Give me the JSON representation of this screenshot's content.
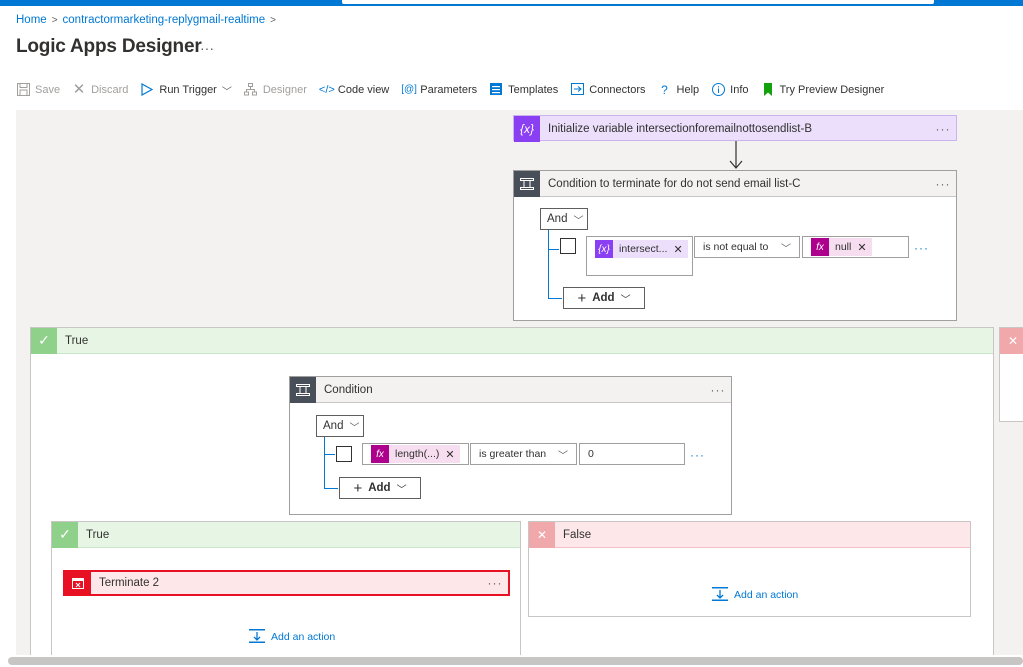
{
  "breadcrumb": {
    "home": "Home",
    "app": "contractormarketing-replygmail-realtime"
  },
  "page": {
    "title": "Logic Apps Designer",
    "more": "···"
  },
  "toolbar": {
    "save": "Save",
    "discard": "Discard",
    "run_trigger": "Run Trigger",
    "designer": "Designer",
    "code_view": "Code view",
    "parameters": "Parameters",
    "templates": "Templates",
    "connectors": "Connectors",
    "help": "Help",
    "info": "Info",
    "try_preview": "Try Preview Designer"
  },
  "init_var": {
    "title": "Initialize variable intersectionforemailnottosendlist-B",
    "icon": "{x}",
    "more": "···"
  },
  "cond_c": {
    "title": "Condition to terminate for do not send email list-C",
    "more": "···",
    "and_label": "And",
    "token": "intersect...",
    "token_icon": "{x}",
    "operator": "is not equal to",
    "value_token": "null",
    "value_icon": "fx",
    "add_label": "Add",
    "row_more": "···"
  },
  "true_outer": {
    "label": "True"
  },
  "cond_inner": {
    "title": "Condition",
    "more": "···",
    "and_label": "And",
    "token": "length(...)",
    "token_icon": "fx",
    "operator": "is greater than",
    "value": "0",
    "add_label": "Add",
    "row_more": "···"
  },
  "true_inner": {
    "label": "True",
    "action_title": "Terminate 2",
    "action_more": "···",
    "add_action": "Add an action"
  },
  "false_inner": {
    "label": "False",
    "add_action": "Add an action"
  },
  "colors": {
    "accent": "#0078d4",
    "variable": "#8b3ff2",
    "expression": "#ad008c",
    "terminate": "#e81123",
    "condition": "#484f58"
  }
}
